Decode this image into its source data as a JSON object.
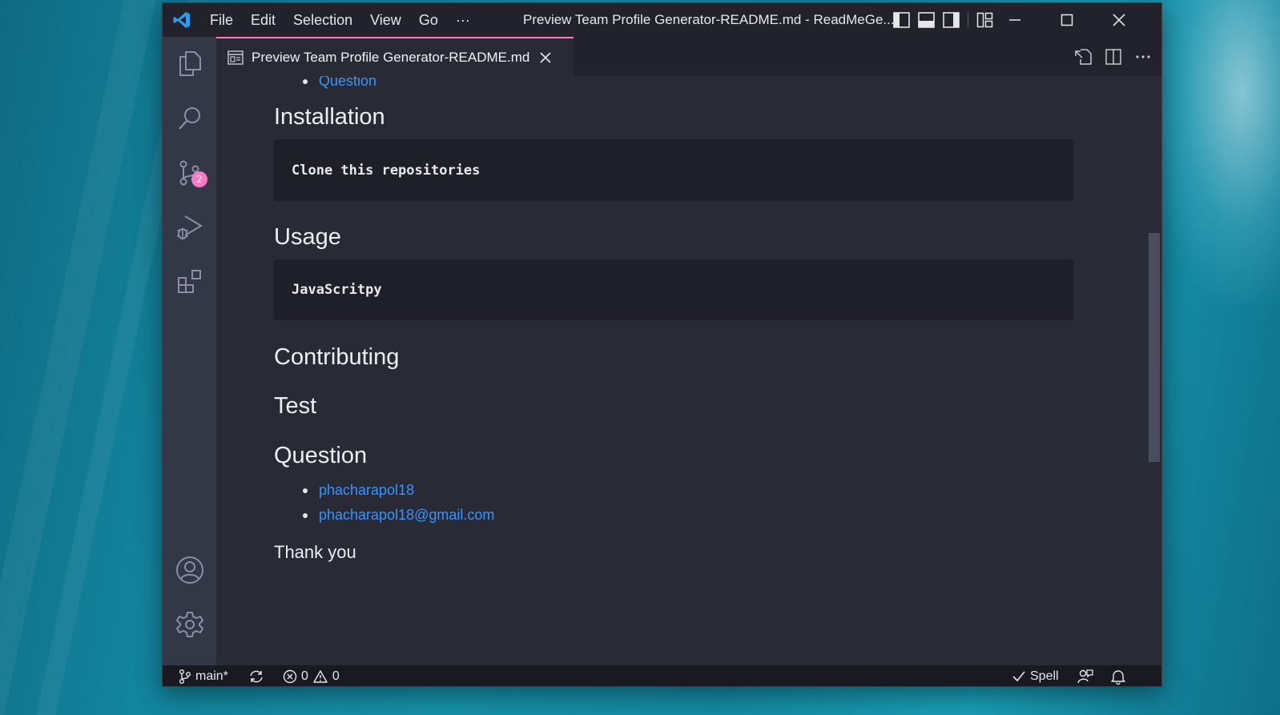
{
  "window": {
    "title": "Preview Team Profile Generator-README.md - ReadMeGe...",
    "menu": [
      "File",
      "Edit",
      "Selection",
      "View",
      "Go",
      "···"
    ]
  },
  "activity_bar": {
    "scm_badge": "2"
  },
  "tab": {
    "label": "Preview Team Profile Generator-README.md"
  },
  "preview": {
    "top_link": "Question",
    "installation_heading": "Installation",
    "installation_code": "Clone this repositories",
    "usage_heading": "Usage",
    "usage_code": "JavaScritpy",
    "contributing_heading": "Contributing",
    "test_heading": "Test",
    "question_heading": "Question",
    "question_links": [
      "phacharapol18",
      "phacharapol18@gmail.com"
    ],
    "closing": "Thank you"
  },
  "status_bar": {
    "branch": "main*",
    "errors": "0",
    "warnings": "0",
    "spell": "Spell"
  },
  "colors": {
    "accent": "#ff79c6",
    "link": "#3794ff",
    "editor_bg": "#282a36",
    "titlebar_bg": "#21222c"
  }
}
